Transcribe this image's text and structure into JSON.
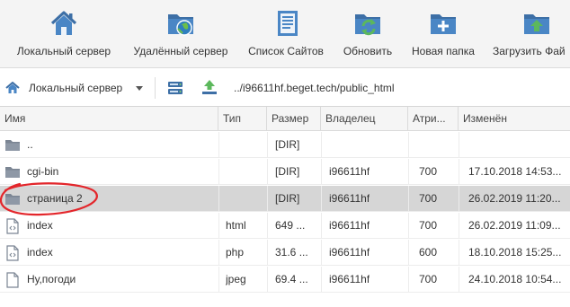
{
  "toolbar": {
    "buttons": [
      {
        "label": "Локальный сервер",
        "icon": "home-icon"
      },
      {
        "label": "Удалённый сервер",
        "icon": "remote-server-icon"
      },
      {
        "label": "Список Сайтов",
        "icon": "site-list-icon"
      },
      {
        "label": "Обновить",
        "icon": "refresh-icon"
      },
      {
        "label": "Новая папка",
        "icon": "new-folder-icon"
      },
      {
        "label": "Загрузить Фай",
        "icon": "upload-icon"
      }
    ]
  },
  "pathbar": {
    "location_label": "Локальный сервер",
    "path": "../i96611hf.beget.tech/public_html"
  },
  "table": {
    "columns": [
      "Имя",
      "Тип",
      "Размер",
      "Владелец",
      "Атри...",
      "Изменён"
    ],
    "rows": [
      {
        "name": "..",
        "type": "",
        "size": "[DIR]",
        "owner": "",
        "attr": "",
        "modified": "",
        "icon": "folder-icon",
        "selected": false
      },
      {
        "name": "cgi-bin",
        "type": "",
        "size": "[DIR]",
        "owner": "i96611hf",
        "attr": "700",
        "modified": "17.10.2018 14:53...",
        "icon": "folder-icon",
        "selected": false
      },
      {
        "name": "страница 2",
        "type": "",
        "size": "[DIR]",
        "owner": "i96611hf",
        "attr": "700",
        "modified": "26.02.2019 11:20...",
        "icon": "folder-icon",
        "selected": true
      },
      {
        "name": "index",
        "type": "html",
        "size": "649 ...",
        "owner": "i96611hf",
        "attr": "700",
        "modified": "26.02.2019 11:09...",
        "icon": "code-file-icon",
        "selected": false
      },
      {
        "name": "index",
        "type": "php",
        "size": "31.6 ...",
        "owner": "i96611hf",
        "attr": "600",
        "modified": "18.10.2018 15:25...",
        "icon": "code-file-icon",
        "selected": false
      },
      {
        "name": "Ну,погоди",
        "type": "jpeg",
        "size": "69.4 ...",
        "owner": "i96611hf",
        "attr": "700",
        "modified": "24.10.2018 10:54...",
        "icon": "file-icon",
        "selected": false
      }
    ]
  },
  "colors": {
    "toolbar_bg": "#f4f4f4",
    "selected_row": "#d6d6d6",
    "annotation_red": "#e3262b"
  }
}
